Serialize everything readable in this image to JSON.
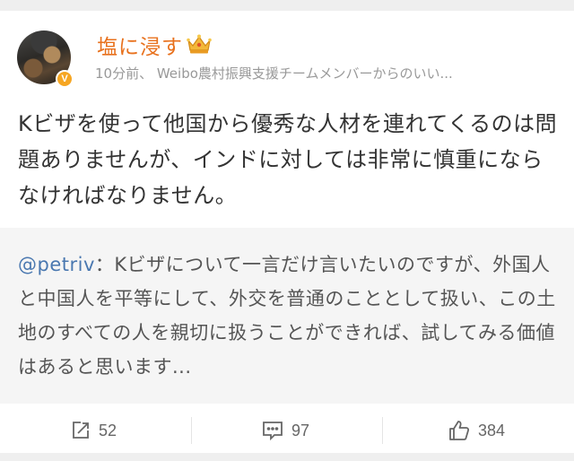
{
  "post": {
    "username": "塩に浸す",
    "meta": "10分前、 Weibo農村振興支援チームメンバーからのいい...",
    "content": "Kビザを使って他国から優秀な人材を連れてくるのは問題ありませんが、インドに対しては非常に慎重にならなければなりません。",
    "verified_badge": "V"
  },
  "repost": {
    "mention": "@petriv",
    "separator": "：",
    "text": "Kビザについて一言だけ言いたいのですが、外国人と中国人を平等にして、外交を普通のこととして扱い、この土地のすべての人を親切に扱うことができれば、試してみる価値はあると思います..."
  },
  "actions": {
    "repost_count": "52",
    "comment_count": "97",
    "like_count": "384"
  },
  "icons": {
    "crown": "crown-icon",
    "repost": "share-arrow-icon",
    "comment": "comment-bubble-icon",
    "like": "thumbs-up-icon"
  },
  "colors": {
    "username": "#e8711d",
    "mention": "#4a78b0",
    "badge": "#f6a623"
  }
}
